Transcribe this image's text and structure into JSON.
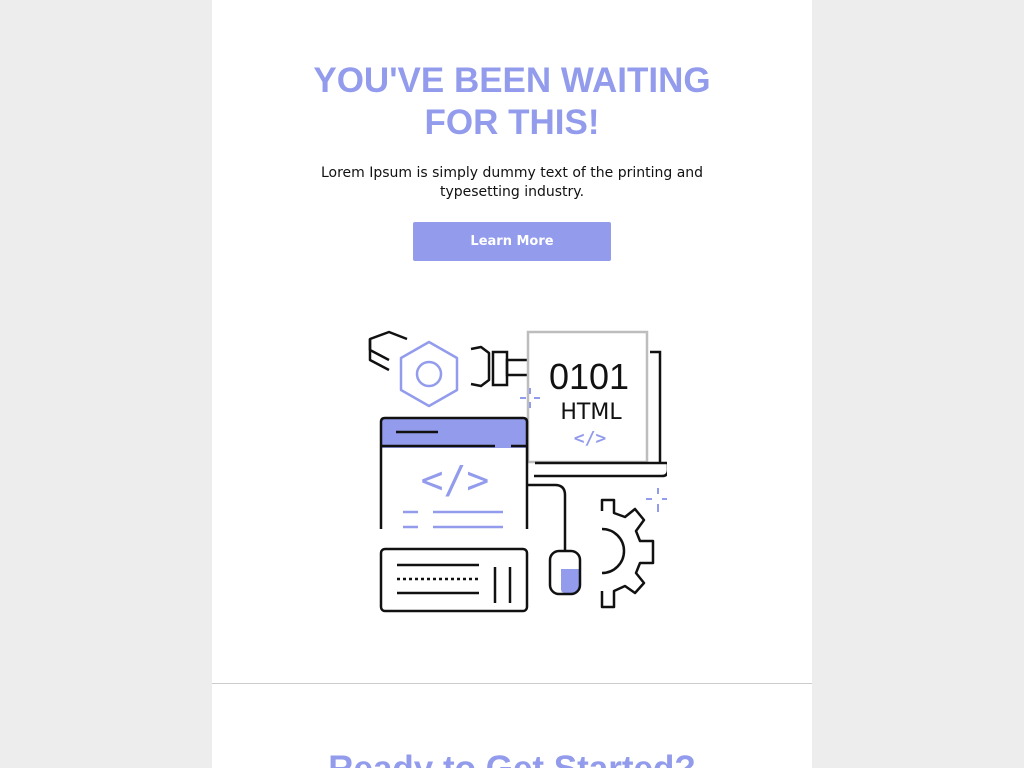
{
  "hero": {
    "title_line1": "YOU'VE BEEN WAITING",
    "title_line2": "FOR THIS!",
    "text_line1": "Lorem Ipsum is simply dummy text of the printing and",
    "text_line2": "typesetting industry.",
    "button_label": "Learn More"
  },
  "illustration": {
    "binary_label": "0101",
    "html_label": "HTML",
    "code_symbol_small": "</>",
    "code_symbol_large": "</>"
  },
  "section2": {
    "title": "Ready to Get Started?"
  },
  "colors": {
    "accent": "#939cec",
    "page_background": "#ededed",
    "card_background": "#ffffff",
    "ink": "#111111"
  }
}
